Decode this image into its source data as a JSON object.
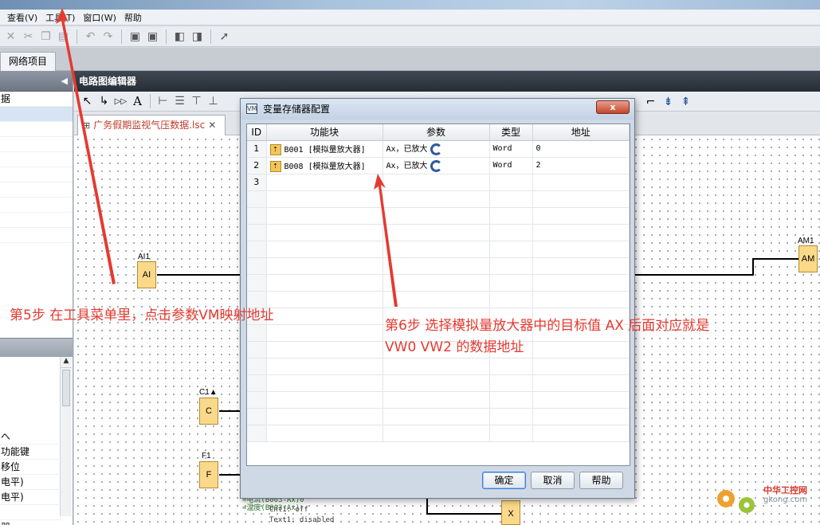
{
  "menu": [
    "查看(V)",
    "工具(T)",
    "窗口(W)",
    "帮助"
  ],
  "project_tab": "网络项目",
  "left_panel": {
    "top_items": [
      "据",
      "",
      "",
      "",
      "",
      "",
      "",
      "",
      "",
      ""
    ],
    "bottom_items": [
      "へ",
      "功能键",
      "移位",
      "电平)",
      "电平)",
      "",
      "器"
    ]
  },
  "editor": {
    "title": "电路图编辑器",
    "doc_tab": "广务假期监视气压数据.lsc",
    "tool_text": "A"
  },
  "canvas": {
    "blocks": [
      {
        "label": "AI1",
        "text": "AI"
      },
      {
        "label": "AM1",
        "text": "AM"
      },
      {
        "label": "C1▲",
        "text": "C"
      },
      {
        "label": "F1",
        "text": "F"
      },
      {
        "label": "",
        "text": "X"
      }
    ],
    "sim_lines": [
      "=电流(B003-Ax)0",
      "=温度(B003-Ax)",
      "Cnt1: off",
      "Text1: disabled"
    ]
  },
  "dialog": {
    "title": "变量存储器配置",
    "close": "x",
    "columns": [
      "ID",
      "功能块",
      "参数",
      "类型",
      "地址"
    ],
    "rows": [
      {
        "id": "1",
        "block": "B001 [模拟量放大器]",
        "param": "Ax，已放大",
        "type": "Word",
        "address": "0"
      },
      {
        "id": "2",
        "block": "B008 [模拟量放大器]",
        "param": "Ax，已放大",
        "type": "Word",
        "address": "2"
      },
      {
        "id": "3",
        "block": "",
        "param": "",
        "type": "",
        "address": ""
      }
    ],
    "buttons": {
      "ok": "确定",
      "cancel": "取消",
      "help": "帮助"
    }
  },
  "annotations": {
    "step5": "第5步 在工具菜单里，点击参数VM映射地址",
    "step6_line1": "第6步 选择模拟量放大器中的目标值 AX 后面对应就是",
    "step6_line2": "VW0 VW2 的数据地址"
  },
  "watermark": {
    "name": "中华工控网",
    "url": "gkong.com"
  },
  "colors": {
    "annotation": "#e53a2f",
    "block_fill": "#fbd98b",
    "editor_header": "#262d35"
  }
}
